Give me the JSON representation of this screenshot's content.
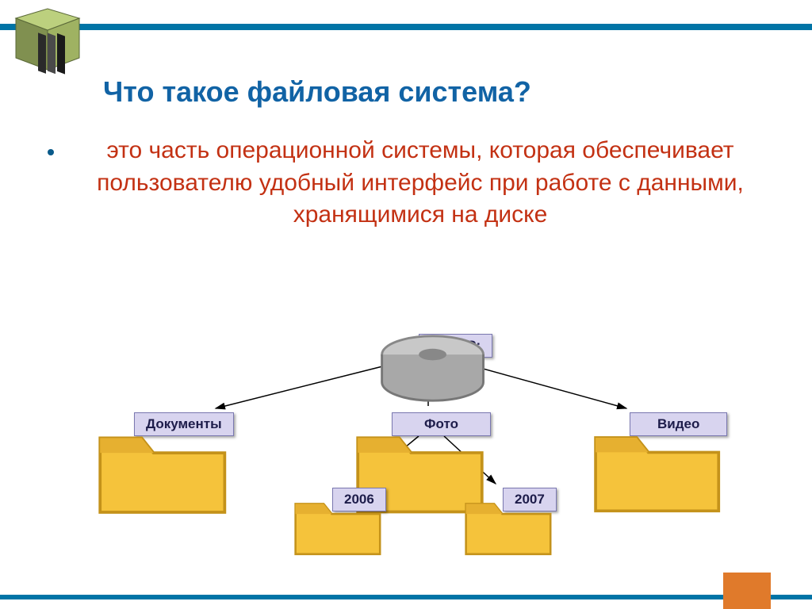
{
  "title": "Что такое файловая система?",
  "bullet": "это часть операционной системы, которая обеспечивает пользователю удобный интерфейс при работе с данными, хранящимися на диске",
  "nodes": {
    "root": "Диск C:",
    "documents": "Документы",
    "photo": "Фото",
    "video": "Видео",
    "year1": "2006",
    "year2": "2007"
  },
  "colors": {
    "bar": "#0074a6",
    "title": "#1163a5",
    "body": "#c33113",
    "nodeFill": "#d8d4ef",
    "nodeBorder": "#7a78b0",
    "orange": "#e07a2b"
  }
}
